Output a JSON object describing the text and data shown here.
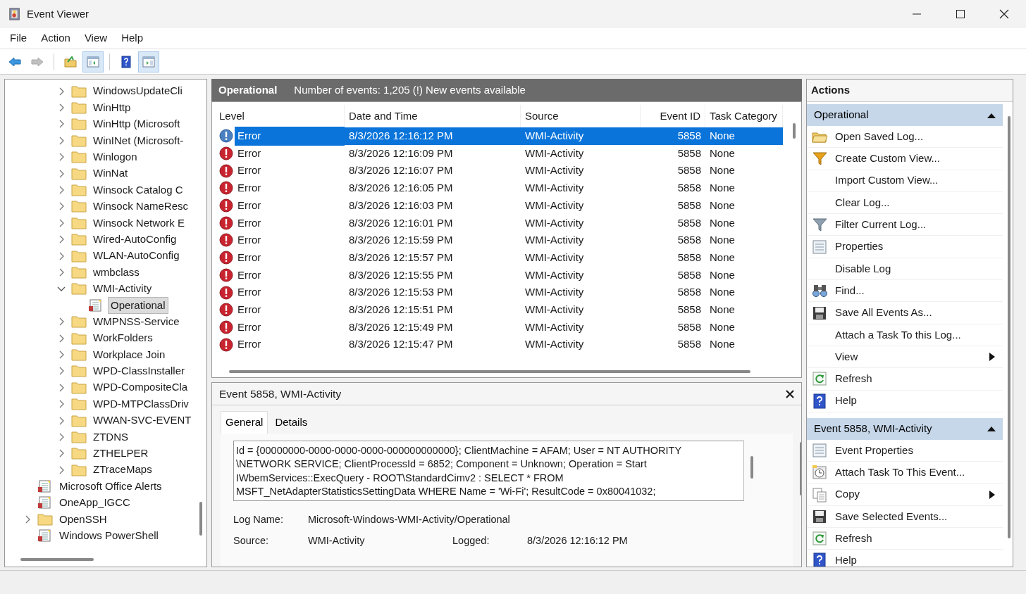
{
  "window": {
    "title": "Event Viewer"
  },
  "menu": [
    "File",
    "Action",
    "View",
    "Help"
  ],
  "toolbar": [
    {
      "kind": "back",
      "disabled": false,
      "pressed": false
    },
    {
      "kind": "forward",
      "disabled": true,
      "pressed": false
    },
    {
      "kind": "up-folder",
      "disabled": false,
      "pressed": false
    },
    {
      "kind": "console-tree",
      "disabled": false,
      "pressed": true
    },
    {
      "kind": "help",
      "disabled": false,
      "pressed": false
    },
    {
      "kind": "action-pane",
      "disabled": false,
      "pressed": true
    }
  ],
  "tree": {
    "continued_children": [
      {
        "label": "WindowsUpdateCli",
        "kind": "folder",
        "expanded": false,
        "selected": false
      },
      {
        "label": "WinHttp",
        "kind": "folder",
        "expanded": false,
        "selected": false
      },
      {
        "label": "WinHttp (Microsoft",
        "kind": "folder",
        "expanded": false,
        "selected": false
      },
      {
        "label": "WinINet (Microsoft-",
        "kind": "folder",
        "expanded": false,
        "selected": false
      },
      {
        "label": "Winlogon",
        "kind": "folder",
        "expanded": false,
        "selected": false
      },
      {
        "label": "WinNat",
        "kind": "folder",
        "expanded": false,
        "selected": false
      },
      {
        "label": "Winsock Catalog C",
        "kind": "folder",
        "expanded": false,
        "selected": false
      },
      {
        "label": "Winsock NameResc",
        "kind": "folder",
        "expanded": false,
        "selected": false
      },
      {
        "label": "Winsock Network E",
        "kind": "folder",
        "expanded": false,
        "selected": false
      },
      {
        "label": "Wired-AutoConfig",
        "kind": "folder",
        "expanded": false,
        "selected": false
      },
      {
        "label": "WLAN-AutoConfig",
        "kind": "folder",
        "expanded": false,
        "selected": false
      },
      {
        "label": "wmbclass",
        "kind": "folder",
        "expanded": false,
        "selected": false
      },
      {
        "label": "WMI-Activity",
        "kind": "folder",
        "expanded": true,
        "selected": false,
        "children": [
          {
            "label": "Operational",
            "kind": "log",
            "selected": true
          }
        ]
      },
      {
        "label": "WMPNSS-Service",
        "kind": "folder",
        "expanded": false,
        "selected": false
      },
      {
        "label": "WorkFolders",
        "kind": "folder",
        "expanded": false,
        "selected": false
      },
      {
        "label": "Workplace Join",
        "kind": "folder",
        "expanded": false,
        "selected": false
      },
      {
        "label": "WPD-ClassInstaller",
        "kind": "folder",
        "expanded": false,
        "selected": false
      },
      {
        "label": "WPD-CompositeCla",
        "kind": "folder",
        "expanded": false,
        "selected": false
      },
      {
        "label": "WPD-MTPClassDriv",
        "kind": "folder",
        "expanded": false,
        "selected": false
      },
      {
        "label": "WWAN-SVC-EVENT",
        "kind": "folder",
        "expanded": false,
        "selected": false
      },
      {
        "label": "ZTDNS",
        "kind": "folder",
        "expanded": false,
        "selected": false
      },
      {
        "label": "ZTHELPER",
        "kind": "folder",
        "expanded": false,
        "selected": false
      },
      {
        "label": "ZTraceMaps",
        "kind": "folder",
        "expanded": false,
        "selected": false
      }
    ],
    "items": [
      {
        "label": "Microsoft Office Alerts",
        "kind": "log",
        "selected": false
      },
      {
        "label": "OneApp_IGCC",
        "kind": "log",
        "selected": false
      },
      {
        "label": "OpenSSH",
        "kind": "folder",
        "expanded": false,
        "selected": false
      },
      {
        "label": "Windows PowerShell",
        "kind": "log",
        "selected": false
      }
    ]
  },
  "log_header": {
    "title": "Operational",
    "summary": "Number of events: 1,205 (!) New events available"
  },
  "table": {
    "columns": [
      "Level",
      "Date and Time",
      "Source",
      "Event ID",
      "Task Category"
    ],
    "rows": [
      {
        "level": "Error",
        "datetime": "8/3/2026 12:16:12 PM",
        "source": "WMI-Activity",
        "event_id": "5858",
        "category": "None",
        "selected": true
      },
      {
        "level": "Error",
        "datetime": "8/3/2026 12:16:09 PM",
        "source": "WMI-Activity",
        "event_id": "5858",
        "category": "None",
        "selected": false
      },
      {
        "level": "Error",
        "datetime": "8/3/2026 12:16:07 PM",
        "source": "WMI-Activity",
        "event_id": "5858",
        "category": "None",
        "selected": false
      },
      {
        "level": "Error",
        "datetime": "8/3/2026 12:16:05 PM",
        "source": "WMI-Activity",
        "event_id": "5858",
        "category": "None",
        "selected": false
      },
      {
        "level": "Error",
        "datetime": "8/3/2026 12:16:03 PM",
        "source": "WMI-Activity",
        "event_id": "5858",
        "category": "None",
        "selected": false
      },
      {
        "level": "Error",
        "datetime": "8/3/2026 12:16:01 PM",
        "source": "WMI-Activity",
        "event_id": "5858",
        "category": "None",
        "selected": false
      },
      {
        "level": "Error",
        "datetime": "8/3/2026 12:15:59 PM",
        "source": "WMI-Activity",
        "event_id": "5858",
        "category": "None",
        "selected": false
      },
      {
        "level": "Error",
        "datetime": "8/3/2026 12:15:57 PM",
        "source": "WMI-Activity",
        "event_id": "5858",
        "category": "None",
        "selected": false
      },
      {
        "level": "Error",
        "datetime": "8/3/2026 12:15:55 PM",
        "source": "WMI-Activity",
        "event_id": "5858",
        "category": "None",
        "selected": false
      },
      {
        "level": "Error",
        "datetime": "8/3/2026 12:15:53 PM",
        "source": "WMI-Activity",
        "event_id": "5858",
        "category": "None",
        "selected": false
      },
      {
        "level": "Error",
        "datetime": "8/3/2026 12:15:51 PM",
        "source": "WMI-Activity",
        "event_id": "5858",
        "category": "None",
        "selected": false
      },
      {
        "level": "Error",
        "datetime": "8/3/2026 12:15:49 PM",
        "source": "WMI-Activity",
        "event_id": "5858",
        "category": "None",
        "selected": false
      },
      {
        "level": "Error",
        "datetime": "8/3/2026 12:15:47 PM",
        "source": "WMI-Activity",
        "event_id": "5858",
        "category": "None",
        "selected": false
      }
    ]
  },
  "details": {
    "title": "Event 5858, WMI-Activity",
    "tabs": [
      {
        "label": "General",
        "selected": true
      },
      {
        "label": "Details",
        "selected": false
      }
    ],
    "description_lines": [
      "Id = {00000000-0000-0000-0000-000000000000}; ClientMachine = AFAM; User = NT AUTHORITY",
      "\\NETWORK SERVICE; ClientProcessId = 6852; Component = Unknown; Operation = Start",
      "IWbemServices::ExecQuery - ROOT\\StandardCimv2 : SELECT * FROM",
      "MSFT_NetAdapterStatisticsSettingData WHERE Name = 'Wi-Fi'; ResultCode = 0x80041032;"
    ],
    "fields": [
      [
        {
          "label": "Log Name:",
          "value": "Microsoft-Windows-WMI-Activity/Operational"
        }
      ],
      [
        {
          "label": "Source:",
          "value": "WMI-Activity"
        },
        {
          "label": "Logged:",
          "value": "8/3/2026 12:16:12 PM"
        }
      ]
    ]
  },
  "actions": {
    "title": "Actions",
    "sections": [
      {
        "title": "Operational",
        "expanded": true,
        "items": [
          {
            "label": "Open Saved Log...",
            "kind": "open-folder",
            "submenu": false
          },
          {
            "label": "Create Custom View...",
            "kind": "funnel-gold",
            "submenu": false
          },
          {
            "label": "Import Custom View...",
            "kind": "plain",
            "submenu": false
          },
          {
            "label": "Clear Log...",
            "kind": "plain",
            "submenu": false
          },
          {
            "label": "Filter Current Log...",
            "kind": "funnel-grey",
            "submenu": false
          },
          {
            "label": "Properties",
            "kind": "properties",
            "submenu": false
          },
          {
            "label": "Disable Log",
            "kind": "plain",
            "submenu": false
          },
          {
            "label": "Find...",
            "kind": "binoculars",
            "submenu": false
          },
          {
            "label": "Save All Events As...",
            "kind": "save",
            "submenu": false
          },
          {
            "label": "Attach a Task To this Log...",
            "kind": "plain",
            "submenu": false
          },
          {
            "label": "View",
            "kind": "plain",
            "submenu": true
          },
          {
            "label": "Refresh",
            "kind": "refresh",
            "submenu": false
          },
          {
            "label": "Help",
            "kind": "help",
            "submenu": false
          }
        ]
      },
      {
        "title": "Event 5858, WMI-Activity",
        "expanded": true,
        "items": [
          {
            "label": "Event Properties",
            "kind": "properties",
            "submenu": false
          },
          {
            "label": "Attach Task To This Event...",
            "kind": "clock",
            "submenu": false
          },
          {
            "label": "Copy",
            "kind": "copy",
            "submenu": true
          },
          {
            "label": "Save Selected Events...",
            "kind": "save",
            "submenu": false
          },
          {
            "label": "Refresh",
            "kind": "refresh",
            "submenu": false
          },
          {
            "label": "Help",
            "kind": "help",
            "submenu": false
          }
        ]
      }
    ]
  }
}
